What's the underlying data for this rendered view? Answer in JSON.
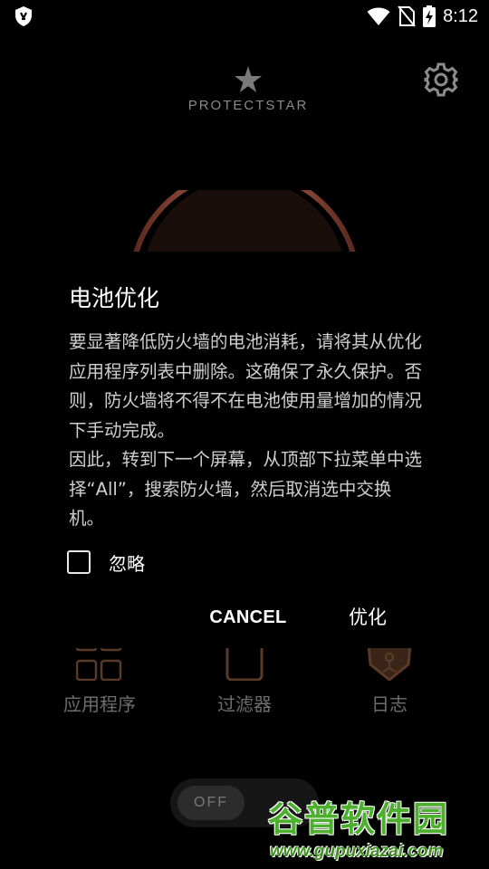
{
  "status_bar": {
    "time": "8:12",
    "icons": [
      "app-shield-icon",
      "wifi-icon",
      "no-sim-icon",
      "battery-charging-icon"
    ]
  },
  "header": {
    "brand": "PROTECTSTAR",
    "logo_icon": "star-icon",
    "settings_icon": "gear-icon"
  },
  "nav": {
    "items": [
      {
        "label": "应用程序",
        "icon": "apps-grid-icon"
      },
      {
        "label": "过滤器",
        "icon": "filter-icon"
      },
      {
        "label": "日志",
        "icon": "log-icon"
      }
    ]
  },
  "toggle": {
    "label": "OFF"
  },
  "dialog": {
    "title": "电池优化",
    "message_p1": "要显著降低防火墙的电池消耗，请将其从优化应用程序列表中删除。这确保了永久保护。否则，防火墙将不得不在电池使用量增加的情况下手动完成。",
    "message_p2": "因此，转到下一个屏幕，从顶部下拉菜单中选择“All”，搜索防火墙，然后取消选中交换机。",
    "checkbox_label": "忽略",
    "checkbox_checked": false,
    "cancel_label": "CANCEL",
    "confirm_label": "优化"
  },
  "watermark": {
    "text": "谷普软件园",
    "url": "www.gupuxiazai.com"
  },
  "colors": {
    "accent_arc": "#c0624a",
    "nav_icon": "#5a3a28",
    "watermark_green": "#4caf2e"
  }
}
